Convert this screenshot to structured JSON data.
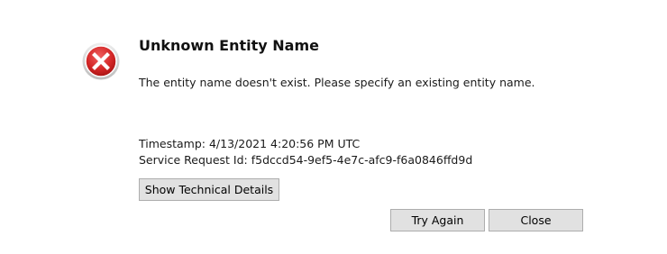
{
  "dialog": {
    "title": "Unknown Entity Name",
    "message": "The entity name doesn't exist. Please specify an existing entity name.",
    "timestamp": "Timestamp: 4/13/2021 4:20:56 PM UTC",
    "service_request": "Service Request Id: f5dccd54-9ef5-4e7c-afc9-f6a0846ffd9d",
    "details_label": "Show Technical Details",
    "try_again_label": "Try Again",
    "close_label": "Close"
  },
  "icon": {
    "name": "error-x-icon",
    "color": "#d32f2f",
    "ring_color": "#c8c8c8"
  }
}
